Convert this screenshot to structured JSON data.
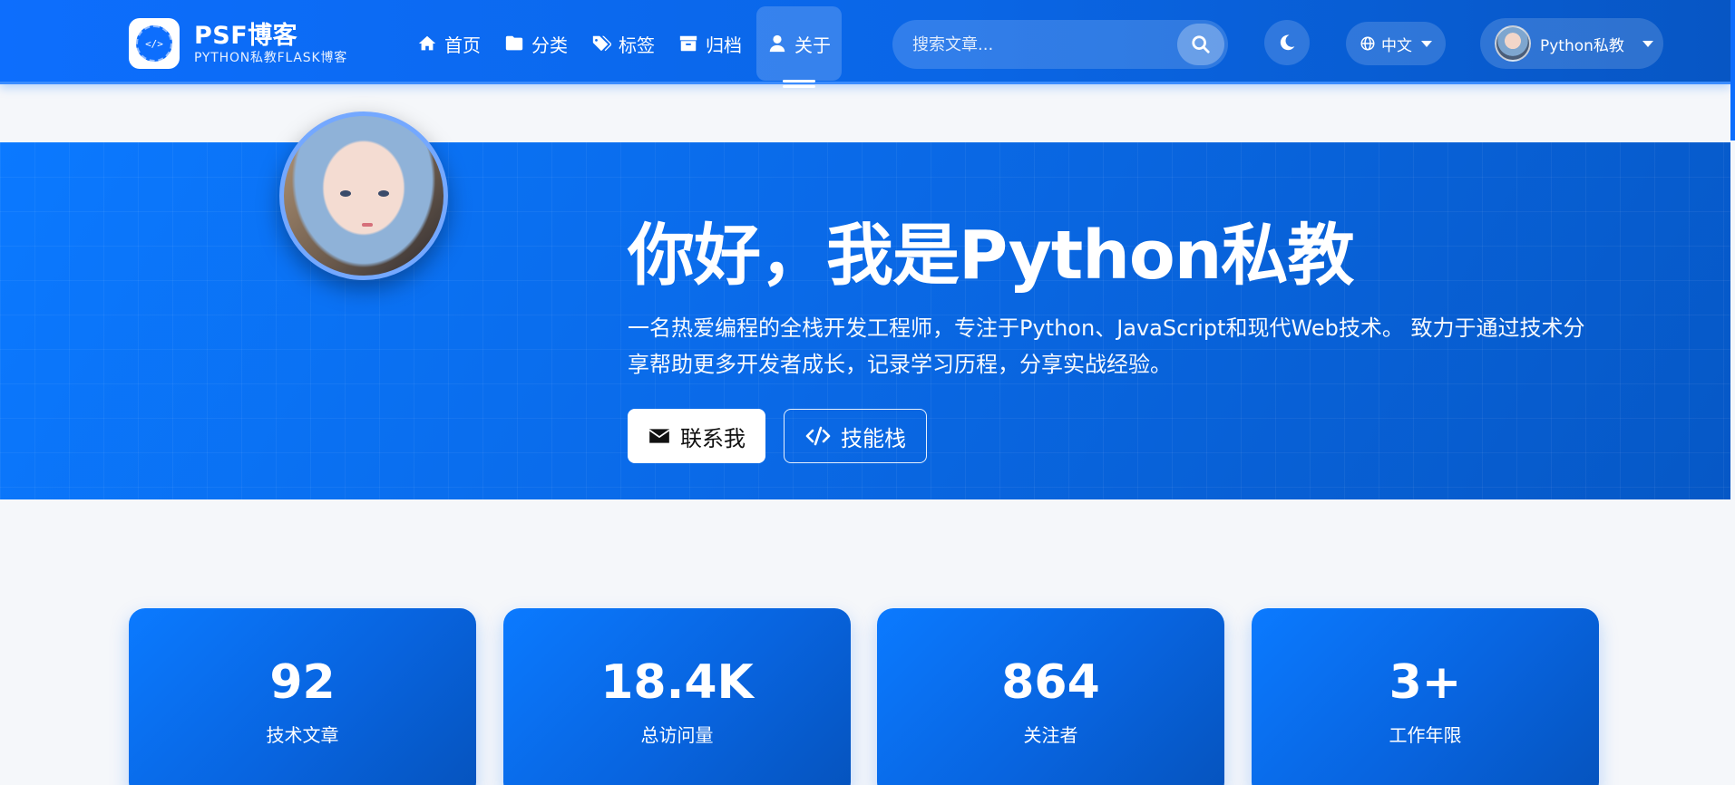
{
  "brand": {
    "title": "PSF博客",
    "subtitle": "PYTHON私教FLASK博客",
    "logo_text": "</>"
  },
  "nav": {
    "items": [
      {
        "label": "首页",
        "icon": "home-icon"
      },
      {
        "label": "分类",
        "icon": "folder-icon"
      },
      {
        "label": "标签",
        "icon": "tags-icon"
      },
      {
        "label": "归档",
        "icon": "archive-icon"
      },
      {
        "label": "关于",
        "icon": "user-icon",
        "active": true
      }
    ]
  },
  "search": {
    "placeholder": "搜索文章..."
  },
  "theme_toggle": {
    "icon": "moon-icon"
  },
  "language": {
    "label": "中文",
    "icon": "globe-icon"
  },
  "user": {
    "name": "Python私教"
  },
  "hero": {
    "title": "你好，我是Python私教",
    "description": "一名热爱编程的全栈开发工程师，专注于Python、JavaScript和现代Web技术。 致力于通过技术分享帮助更多开发者成长，记录学习历程，分享实战经验。",
    "contact_label": "联系我",
    "skills_label": "技能栈"
  },
  "stats": [
    {
      "value": "92",
      "label": "技术文章"
    },
    {
      "value": "18.4K",
      "label": "总访问量"
    },
    {
      "value": "864",
      "label": "关注者"
    },
    {
      "value": "3+",
      "label": "工作年限"
    }
  ],
  "colors": {
    "primary": "#0d6efd",
    "primary_dark": "#0553bd",
    "background": "#f5f7fa"
  }
}
